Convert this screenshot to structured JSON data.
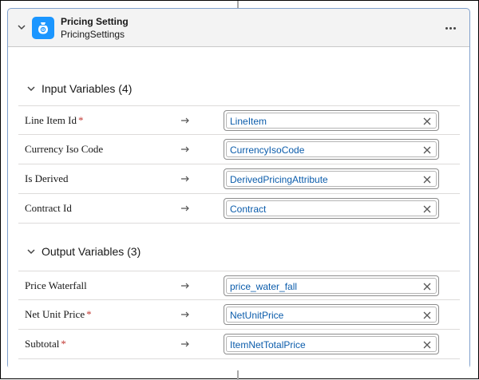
{
  "card": {
    "title": "Pricing Setting",
    "subtitle": "PricingSettings",
    "icon": "pricing-setting-icon",
    "accent_color": "#1b96ff",
    "border_color": "#7fa0cc"
  },
  "input_section": {
    "title": "Input Variables (4)",
    "rows": [
      {
        "label": "Line Item Id",
        "required": "*",
        "value": "LineItem"
      },
      {
        "label": "Currency Iso Code",
        "required": "",
        "value": "CurrencyIsoCode"
      },
      {
        "label": "Is Derived",
        "required": "",
        "value": "DerivedPricingAttribute"
      },
      {
        "label": "Contract Id",
        "required": "",
        "value": "Contract"
      }
    ]
  },
  "output_section": {
    "title": "Output Variables (3)",
    "rows": [
      {
        "label": "Price Waterfall",
        "required": "",
        "value": "price_water_fall"
      },
      {
        "label": "Net Unit Price",
        "required": "*",
        "value": "NetUnitPrice"
      },
      {
        "label": "Subtotal",
        "required": "*",
        "value": "ItemNetTotalPrice"
      }
    ]
  },
  "colors": {
    "value_text": "#0b5cab",
    "required_marker": "#c23934"
  }
}
